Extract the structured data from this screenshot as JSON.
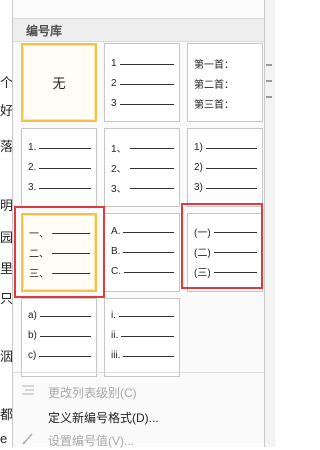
{
  "section_header": "编号库",
  "background_chars": [
    "个",
    "好",
    "落",
    "明",
    "园",
    "里",
    "只",
    "洇",
    "都",
    "e"
  ],
  "tiles": [
    {
      "name": "tile-none",
      "type": "none",
      "text": "无"
    },
    {
      "name": "tile-arabic",
      "lines": [
        "1",
        "2",
        "3"
      ]
    },
    {
      "name": "tile-chapter",
      "lines": [
        "第一首：",
        "第二首：",
        "第三首："
      ]
    },
    {
      "name": "tile-arabic-dot",
      "lines": [
        "1.",
        "2.",
        "3."
      ]
    },
    {
      "name": "tile-arabic-comma",
      "lines": [
        "1、",
        "2、",
        "3、"
      ]
    },
    {
      "name": "tile-arabic-paren",
      "lines": [
        "1)",
        "2)",
        "3)"
      ]
    },
    {
      "name": "tile-chinese",
      "lines": [
        "一、",
        "二、",
        "三、"
      ]
    },
    {
      "name": "tile-upper-alpha",
      "lines": [
        "A.",
        "B.",
        "C."
      ]
    },
    {
      "name": "tile-chinese-paren",
      "lines": [
        "(一)",
        "(二)",
        "(三)"
      ]
    },
    {
      "name": "tile-lower-alpha",
      "lines": [
        "a)",
        "b)",
        "c)"
      ]
    },
    {
      "name": "tile-lower-roman",
      "lines": [
        "i.",
        "ii.",
        "iii."
      ]
    }
  ],
  "menu": {
    "change_level": "更改列表级别(C)",
    "define_format": "定义新编号格式(D)...",
    "set_value": "设置编号值(V)..."
  },
  "colors": {
    "highlight_red": "#e23a3a",
    "selected_gold": "#f2c24c"
  }
}
